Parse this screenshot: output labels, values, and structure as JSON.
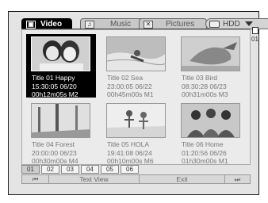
{
  "tabs": [
    {
      "label": "Video",
      "icon": "video-camera-icon",
      "active": true
    },
    {
      "label": "Music",
      "icon": "music-note-icon",
      "active": false
    },
    {
      "label": "Pictures",
      "icon": "butterfly-icon",
      "active": false
    }
  ],
  "source": {
    "label": "HDD",
    "icon": "hard-disk-icon"
  },
  "page_indicator": "01",
  "items": [
    {
      "title": "Title 01 Happy",
      "datetime": "15:30:05 06/20",
      "duration": "00h12m05s M2",
      "selected": true
    },
    {
      "title": "Title 02 Sea",
      "datetime": "23:00:05 06/22",
      "duration": "00h45m00s M1",
      "selected": false
    },
    {
      "title": "Title 03 Bird",
      "datetime": "08:30:28 06/23",
      "duration": "00h31m00s M3",
      "selected": false
    },
    {
      "title": "Title 04 Forest",
      "datetime": "20:00:00 06/23",
      "duration": "00h30m00s M4",
      "selected": false
    },
    {
      "title": "Title 05 HOLA",
      "datetime": "19:41:08 06/24",
      "duration": "00h10m00s M6",
      "selected": false
    },
    {
      "title": "Title 06 Home",
      "datetime": "01:20:56 06/26",
      "duration": "01h30m00s M1",
      "selected": false
    }
  ],
  "pages": [
    "01",
    "02",
    "03",
    "04",
    "05",
    "06"
  ],
  "navbar": {
    "prev_icon": "skip-back-icon",
    "text_view": "Text View",
    "exit": "Exit",
    "next_icon": "skip-forward-icon"
  }
}
